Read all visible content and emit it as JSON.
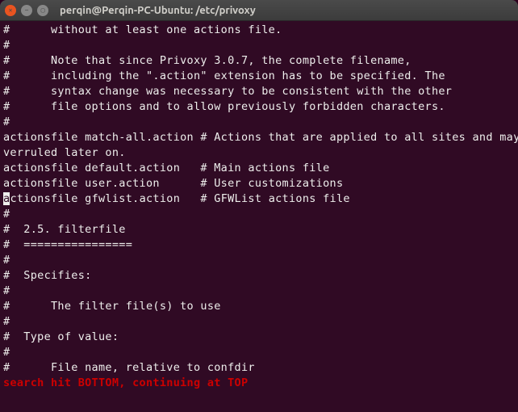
{
  "window": {
    "title": "perqin@Perqin-PC-Ubuntu: /etc/privoxy"
  },
  "lines": [
    "#      without at least one actions file.",
    "#",
    "#      Note that since Privoxy 3.0.7, the complete filename,",
    "#      including the \".action\" extension has to be specified. The",
    "#      syntax change was necessary to be consistent with the other",
    "#      file options and to allow previously forbidden characters.",
    "#",
    "actionsfile match-all.action # Actions that are applied to all sites and maybe o",
    "verruled later on.",
    "actionsfile default.action   # Main actions file",
    "actionsfile user.action      # User customizations",
    "actionsfile gfwlist.action   # GFWList actions file",
    "#",
    "#  2.5. filterfile",
    "#  ================",
    "#",
    "#  Specifies:",
    "#",
    "#      The filter file(s) to use",
    "#",
    "#  Type of value:",
    "#",
    "#      File name, relative to confdir"
  ],
  "cursor": {
    "line": 11,
    "col": 0
  },
  "status": "search hit BOTTOM, continuing at TOP"
}
